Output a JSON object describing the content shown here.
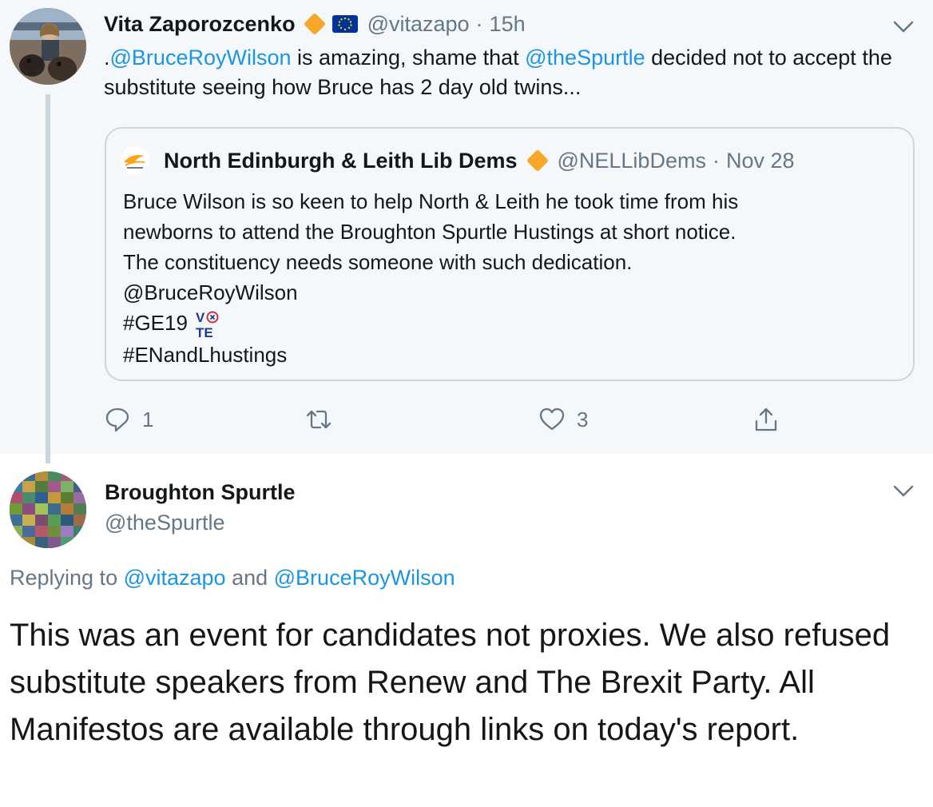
{
  "parent_tweet": {
    "author_name": "Vita Zaporozcenko",
    "author_handle": "@vitazapo",
    "separator": "·",
    "time": "15h",
    "text_prefix": ".",
    "mention_1": "@BruceRoyWilson",
    "text_mid": " is amazing, shame that ",
    "mention_2": "@theSpurtle",
    "text_end": " decided not to accept the substitute seeing how Bruce has 2 day old twins...",
    "quoted": {
      "author_name": "North Edinburgh & Leith Lib Dems",
      "author_handle": "@NELLibDems",
      "separator": "·",
      "date": "Nov 28",
      "avatar_logo_text": "LIBERAL DEMOCRAT",
      "lines": [
        "Bruce Wilson is so keen to help North & Leith he took time from his",
        "newborns to attend the Broughton Spurtle Hustings at short notice.",
        "The constituency needs someone with such dedication.",
        "@BruceRoyWilson",
        "#GE19",
        "#ENandLhustings"
      ],
      "vote_emoji": "VOTE"
    },
    "actions": {
      "reply_count": "1",
      "retweet_count": "",
      "like_count": "3"
    },
    "colors": {
      "background": "#f5f8fa",
      "link": "#1b95e0",
      "verified_diamond": "#f7a72a"
    }
  },
  "reply_tweet": {
    "author_name": "Broughton Spurtle",
    "author_handle": "@theSpurtle",
    "replying_prefix": "Replying to ",
    "replying_user_1": "@vitazapo",
    "replying_and": " and ",
    "replying_user_2": "@BruceRoyWilson",
    "text": "This was an event for candidates not proxies. We also refused substitute speakers from Renew and The Brexit Party. All Manifestos are available through links on today's report."
  }
}
